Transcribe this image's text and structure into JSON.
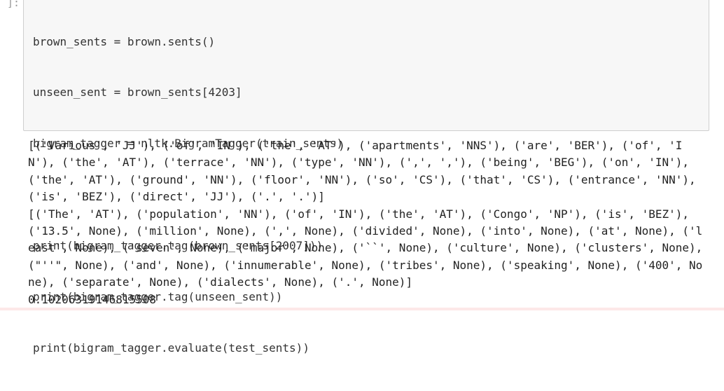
{
  "cell": {
    "prompt": "]:",
    "code_lines": [
      "brown_sents = brown.sents()",
      "unseen_sent = brown_sents[4203]",
      "bigram_tagger = nltk.BigramTagger(train_sents)",
      "",
      "print(bigram_tagger.tag(brown_sents[2007]))",
      "print(bigram_tagger.tag(unseen_sent))",
      "print(bigram_tagger.evaluate(test_sents))"
    ],
    "output_lines": [
      "[('Various', 'JJ'), ('of', 'IN'), ('the', 'AT'), ('apartments', 'NNS'), ('are', 'BER'), ('of', 'I",
      "N'), ('the', 'AT'), ('terrace', 'NN'), ('type', 'NN'), (',', ','), ('being', 'BEG'), ('on', 'IN'),",
      "('the', 'AT'), ('ground', 'NN'), ('floor', 'NN'), ('so', 'CS'), ('that', 'CS'), ('entrance', 'NN'),",
      "('is', 'BEZ'), ('direct', 'JJ'), ('.', '.')]",
      "[('The', 'AT'), ('population', 'NN'), ('of', 'IN'), ('the', 'AT'), ('Congo', 'NP'), ('is', 'BEZ'),",
      "('13.5', None), ('million', None), (',', None), ('divided', None), ('into', None), ('at', None), ('l",
      "east', None), ('seven', None), ('major', None), ('``', None), ('culture', None), ('clusters', None),",
      "(\"''\", None), ('and', None), ('innumerable', None), ('tribes', None), ('speaking', None), ('400', No",
      "ne), ('separate', None), ('dialects', None), ('.', None)]",
      "0.10206319146815508"
    ]
  }
}
